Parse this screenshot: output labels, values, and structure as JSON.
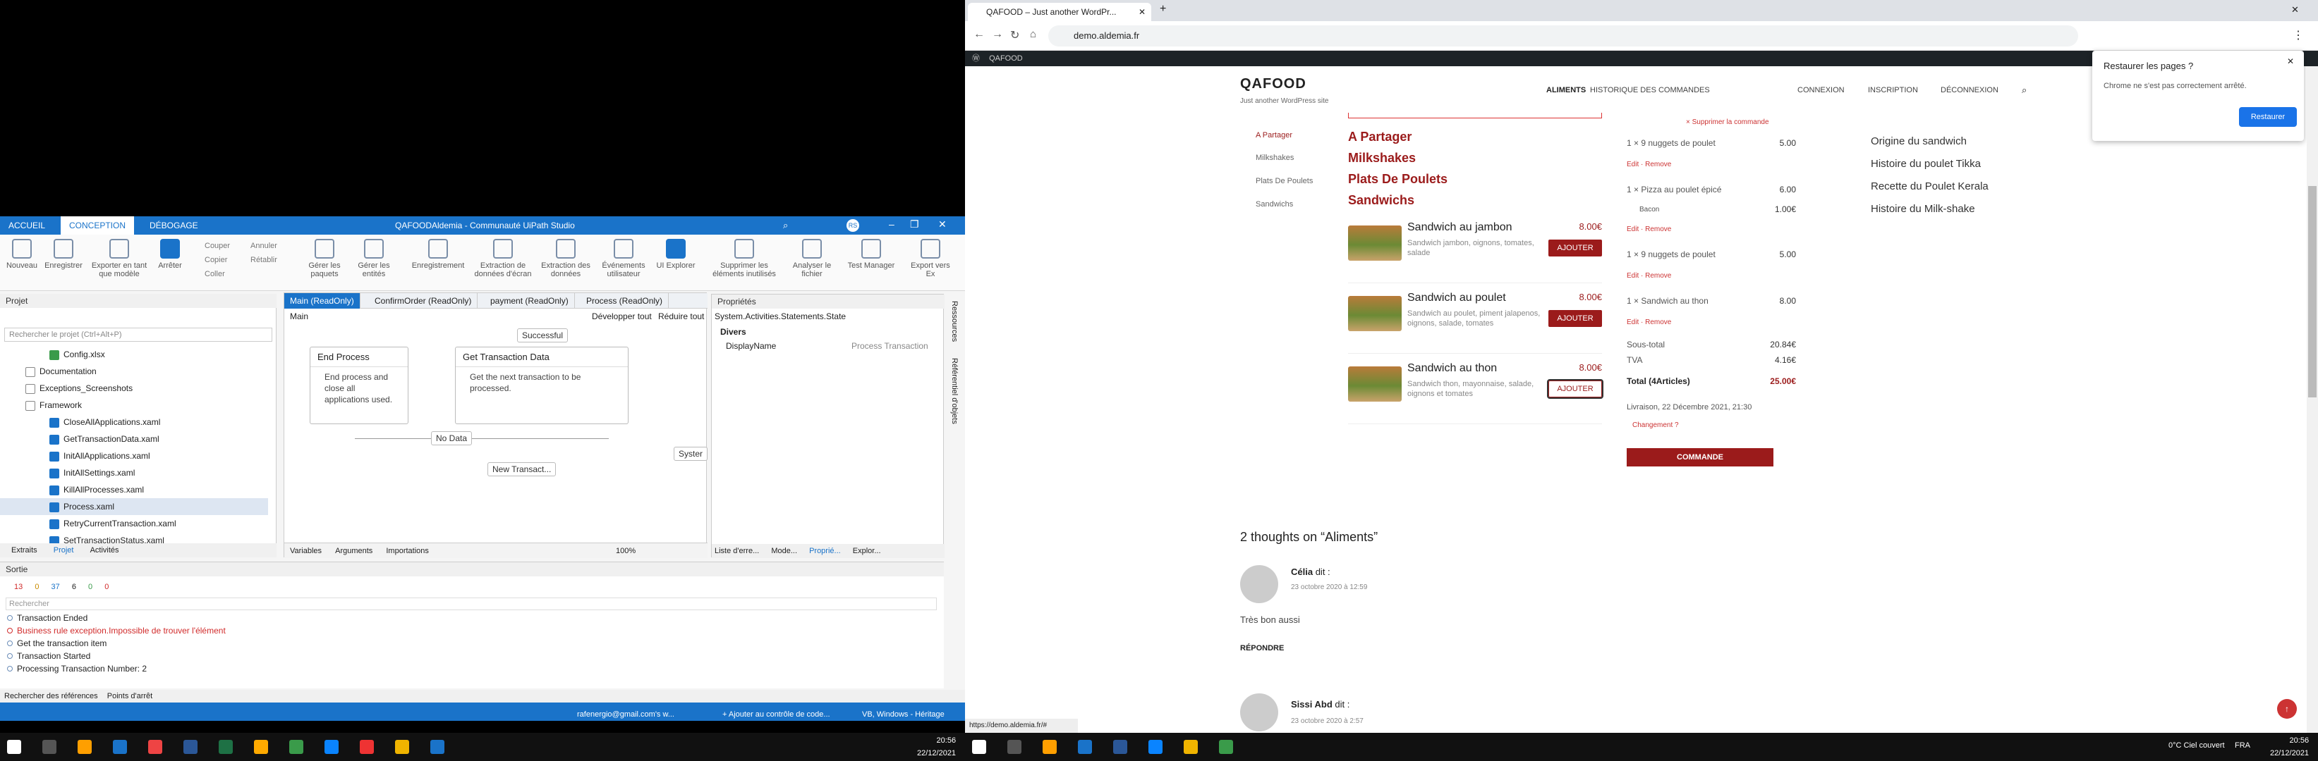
{
  "studio": {
    "title": "QAFOODAldemia - Communauté UiPath Studio",
    "tabs": [
      "ACCUEIL",
      "CONCEPTION",
      "DÉBOGAGE"
    ],
    "user_initials": "RS",
    "ribbon": {
      "new": "Nouveau",
      "save": "Enregistrer",
      "export_template": "Exporter en tant que modèle",
      "stop": "Arrêter",
      "cut": "Couper",
      "copy": "Copier",
      "paste": "Coller",
      "undo": "Annuler",
      "redo": "Rétablir",
      "manage_packages": "Gérer les paquets",
      "manage_entities": "Gérer les entités",
      "record": "Enregistrement",
      "screen_scraping": "Extraction de données d'écran",
      "data_scraping": "Extraction des données",
      "user_events": "Événements utilisateur",
      "ui_explorer": "UI Explorer",
      "remove_unused": "Supprimer les éléments inutilisés",
      "analyze_file": "Analyser le fichier",
      "test_manager": "Test Manager",
      "export_excel": "Export vers Ex"
    },
    "project": {
      "header": "Projet",
      "search_placeholder": "Rechercher le projet (Ctrl+Alt+P)",
      "items": [
        "Config.xlsx",
        "Documentation",
        "Exceptions_Screenshots",
        "Framework",
        "CloseAllApplications.xaml",
        "GetTransactionData.xaml",
        "InitAllApplications.xaml",
        "InitAllSettings.xaml",
        "KillAllProcesses.xaml",
        "Process.xaml",
        "RetryCurrentTransaction.xaml",
        "SetTransactionStatus.xaml"
      ],
      "bottom_tabs": [
        "Extraits",
        "Projet",
        "Activités"
      ]
    },
    "doc_tabs": [
      "Main (ReadOnly)",
      "ConfirmOrder (ReadOnly)",
      "payment (ReadOnly)",
      "Process (ReadOnly)"
    ],
    "designer": {
      "breadcrumb": "Main",
      "expand_all": "Développer tout",
      "collapse_all": "Réduire tout",
      "successful": "Successful",
      "end_process_title": "End Process",
      "end_process_body": "End process and close all applications used.",
      "get_tx_title": "Get Transaction Data",
      "get_tx_body": "Get the next transaction to be processed.",
      "no_data": "No Data",
      "new_transaction": "New Transact...",
      "system": "Syster",
      "bottom": {
        "variables": "Variables",
        "arguments": "Arguments",
        "imports": "Importations",
        "zoom": "100%"
      }
    },
    "properties": {
      "header": "Propriétés",
      "class": "System.Activities.Statements.State",
      "section": "Divers",
      "field": "DisplayName",
      "value": "Process Transaction",
      "side_tabs": [
        "Ressources",
        "Référentiel d'objets"
      ],
      "bottom_tabs": [
        "Liste d'erre...",
        "Mode...",
        "Proprié...",
        "Explor..."
      ]
    },
    "output": {
      "header": "Sortie",
      "counts": {
        "errors": "13",
        "warnings": "0",
        "info": "37",
        "trace": "6",
        "verbose": "0",
        "alerts": "0"
      },
      "search_placeholder": "Rechercher",
      "lines": [
        {
          "text": "Transaction Ended",
          "type": "info"
        },
        {
          "text": "Business rule exception.Impossible de trouver l'élément",
          "type": "error"
        },
        {
          "text": "Get the transaction item",
          "type": "info"
        },
        {
          "text": "Transaction Started",
          "type": "info"
        },
        {
          "text": "Processing Transaction Number: 2",
          "type": "info"
        }
      ],
      "bottom_tabs": [
        "Rechercher des références",
        "Points d'arrêt"
      ]
    },
    "status": {
      "account": "rafenergio@gmail.com's w...",
      "source_control": "+ Ajouter au contrôle de code...",
      "platform": "VB, Windows - Héritage"
    }
  },
  "chrome": {
    "tab_title": "QAFOOD – Just another WordPr...",
    "url": "demo.aldemia.fr",
    "wp_site": "QAFOOD",
    "restore_popup": {
      "title": "Restaurer les pages ?",
      "message": "Chrome ne s'est pas correctement arrêté.",
      "button": "Restaurer"
    },
    "status_url": "https://demo.aldemia.fr/#"
  },
  "site": {
    "title": "QAFOOD",
    "tagline": "Just another WordPress site",
    "nav": [
      "ALIMENTS",
      "HISTORIQUE DES COMMANDES",
      "CONNEXION",
      "INSCRIPTION",
      "DÉCONNEXION"
    ],
    "side_links": [
      "A Partager",
      "Milkshakes",
      "Plats De Poulets",
      "Sandwichs"
    ],
    "categories": [
      "A Partager",
      "Milkshakes",
      "Plats De Poulets",
      "Sandwichs"
    ],
    "products": [
      {
        "name": "Sandwich au jambon",
        "price": "8.00€",
        "desc": "Sandwich jambon, oignons, tomates, salade",
        "button": "AJOUTER"
      },
      {
        "name": "Sandwich au poulet",
        "price": "8.00€",
        "desc": "Sandwich au poulet, piment jalapenos, oignons, salade, tomates",
        "button": "AJOUTER"
      },
      {
        "name": "Sandwich au thon",
        "price": "8.00€",
        "desc": "Sandwich thon, mayonnaise, salade, oignons et tomates",
        "button": "AJOUTER"
      }
    ],
    "cart": {
      "remove_top": "× Supprimer la commande",
      "items": [
        {
          "qty": "1 ×",
          "name": "9 nuggets de poulet",
          "price": "5.00",
          "actions": "Edit · Remove"
        },
        {
          "qty": "1 ×",
          "name": "Pizza au poulet épicé",
          "price": "6.00",
          "extra": "Bacon",
          "extra_price": "1.00€",
          "actions": "Edit · Remove"
        },
        {
          "qty": "1 ×",
          "name": "9 nuggets de poulet",
          "price": "5.00",
          "actions": "Edit · Remove"
        },
        {
          "qty": "1 ×",
          "name": "Sandwich au thon",
          "price": "8.00",
          "actions": "Edit · Remove"
        }
      ],
      "subtotal_label": "Sous-total",
      "subtotal": "20.84€",
      "tva_label": "TVA",
      "tva": "4.16€",
      "total_label": "Total (4Articles)",
      "total": "25.00€",
      "delivery": "Livraison, 22 Décembre 2021, 21:30",
      "change": "Changement ?",
      "order_button": "COMMANDE"
    },
    "right_links": [
      "Origine du sandwich",
      "Histoire du poulet Tikka",
      "Recette du Poulet Kerala",
      "Histoire du Milk-shake"
    ],
    "comments_title": "2 thoughts on “Aliments”",
    "comments": [
      {
        "author": "Célia",
        "says": "dit :",
        "date": "23 octobre 2020 à 12:59",
        "text": "Très bon aussi",
        "reply": "RÉPONDRE"
      },
      {
        "author": "Sissi Abd",
        "says": "dit :",
        "date": "23 octobre 2020 à 2:57"
      }
    ]
  },
  "taskbar_left": {
    "time": "20:56",
    "date": "22/12/2021"
  },
  "taskbar_right": {
    "weather": "0°C  Ciel couvert",
    "lang": "FRA",
    "time": "20:56",
    "date": "22/12/2021"
  }
}
